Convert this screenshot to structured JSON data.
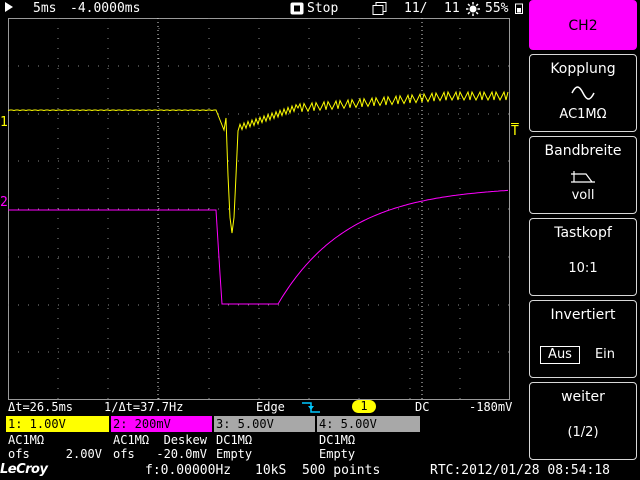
{
  "topbar": {
    "timebase": "5ms",
    "offset": "-4.0000ms",
    "state": "Stop",
    "acq": "11/",
    "total": "11",
    "battery": "55%"
  },
  "markers": {
    "ch1": "1",
    "ch2": "2",
    "trig_right": "T"
  },
  "measure": {
    "dt": "Δt=26.5ms",
    "inv_dt": "1/Δt=37.7Hz",
    "trigger_type": "Edge",
    "trigger_source": "1",
    "coupling": "DC",
    "level": "-180mV"
  },
  "channels": [
    {
      "label": "1: 1.00V",
      "line1": "AC1MΩ",
      "line2": "ofs     2.00V",
      "color": "#ffff00"
    },
    {
      "label": "2: 200mV",
      "line1": "AC1MΩ  Deskew",
      "line2": "ofs   -20.0mV",
      "color": "#ff00ff"
    },
    {
      "label": "3: 5.00V",
      "line1": "DC1MΩ",
      "line2": "Empty",
      "color": "#a0a0a0"
    },
    {
      "label": "4: 5.00V",
      "line1": "DC1MΩ",
      "line2": "Empty",
      "color": "#a0a0a0"
    }
  ],
  "footer": {
    "brand": "LeCroy",
    "freq": "f:0.00000Hz",
    "rate": "10kS",
    "points": "500 points",
    "rtc": "RTC:2012/01/28 08:54:18"
  },
  "menu": {
    "ch": "CH2",
    "kopplung": "Kopplung",
    "kopplung_val": "AC1MΩ",
    "bandbreite": "Bandbreite",
    "bandbreite_val": "voll",
    "tastkopf": "Tastkopf",
    "tastkopf_val": "10:1",
    "invertiert": "Invertiert",
    "inv_aus": "Aus",
    "inv_ein": "Ein",
    "weiter": "weiter",
    "page": "(1/2)"
  },
  "colors": {
    "ch1": "#ffff00",
    "ch2": "#ff00ff",
    "accent": "#ff00ff",
    "cursor": "#00c8ff"
  }
}
